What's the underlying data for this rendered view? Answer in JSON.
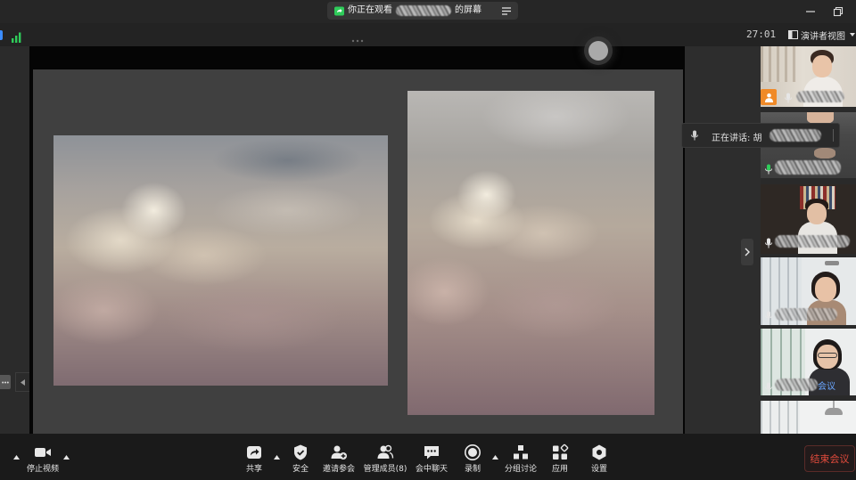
{
  "window": {
    "banner_prefix": "你正在观看",
    "banner_suffix": "的屏幕"
  },
  "meeting_bar": {
    "timer": "27:01",
    "view_label": "演讲者视图"
  },
  "speaking": {
    "label": "正在讲话: 胡"
  },
  "participants": {
    "tile5_name": "会议"
  },
  "toolbar": {
    "stop_video": "停止视频",
    "share": "共享",
    "security": "安全",
    "invite": "邀请参会",
    "manage_participants": "管理成员(8)",
    "chat": "会中聊天",
    "record": "录制",
    "breakout_rooms": "分组讨论",
    "apps": "应用",
    "settings": "设置",
    "end_meeting": "结束会议"
  },
  "icons": {
    "banner": "screen-share-icon",
    "banner_menu": "menu-icon",
    "minimize": "minimize-icon",
    "restore": "restore-icon",
    "signal": "signal-bars-icon",
    "view_switch": "grid-view-icon",
    "video": "video-camera-icon",
    "share": "share-screen-icon",
    "security": "shield-icon",
    "invite": "add-person-icon",
    "participants": "people-icon",
    "chat": "chat-bubble-icon",
    "record": "record-icon",
    "breakout": "breakout-rooms-icon",
    "apps": "apps-icon",
    "settings": "settings-icon",
    "mic": "microphone-icon",
    "collapse": "chevron-right-icon"
  },
  "colors": {
    "accent_green": "#2fcc5a",
    "end_meeting_red": "#e34b3c",
    "avatar_badge_orange": "#f08a28",
    "name_highlight_blue": "#6aa6ff"
  }
}
